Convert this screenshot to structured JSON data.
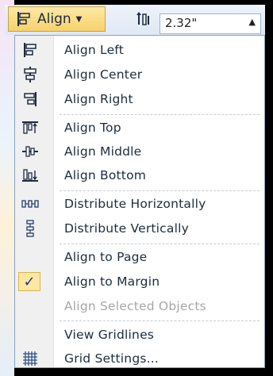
{
  "ribbon": {
    "align_button_label": "Align",
    "value_field": "2.32\""
  },
  "menu": {
    "items": [
      {
        "label": "Align Left",
        "icon": "align-left-icon"
      },
      {
        "label": "Align Center",
        "icon": "align-center-icon"
      },
      {
        "label": "Align Right",
        "icon": "align-right-icon"
      },
      {
        "label": "Align Top",
        "icon": "align-top-icon"
      },
      {
        "label": "Align Middle",
        "icon": "align-middle-icon"
      },
      {
        "label": "Align Bottom",
        "icon": "align-bottom-icon"
      },
      {
        "label": "Distribute Horizontally",
        "icon": "distribute-horizontally-icon"
      },
      {
        "label": "Distribute Vertically",
        "icon": "distribute-vertically-icon"
      },
      {
        "label": "Align to Page",
        "icon": ""
      },
      {
        "label": "Align to Margin",
        "icon": "checkmark-icon",
        "checked": true
      },
      {
        "label": "Align Selected Objects",
        "icon": "",
        "disabled": true
      },
      {
        "label": "View Gridlines",
        "icon": ""
      },
      {
        "label": "Grid Settings...",
        "icon": "grid-settings-icon"
      }
    ]
  },
  "colors": {
    "highlight": "#fde7a3",
    "menu_border": "#8aa2bf",
    "text": "#1e2b3d",
    "disabled_text": "#a7a7a7"
  }
}
